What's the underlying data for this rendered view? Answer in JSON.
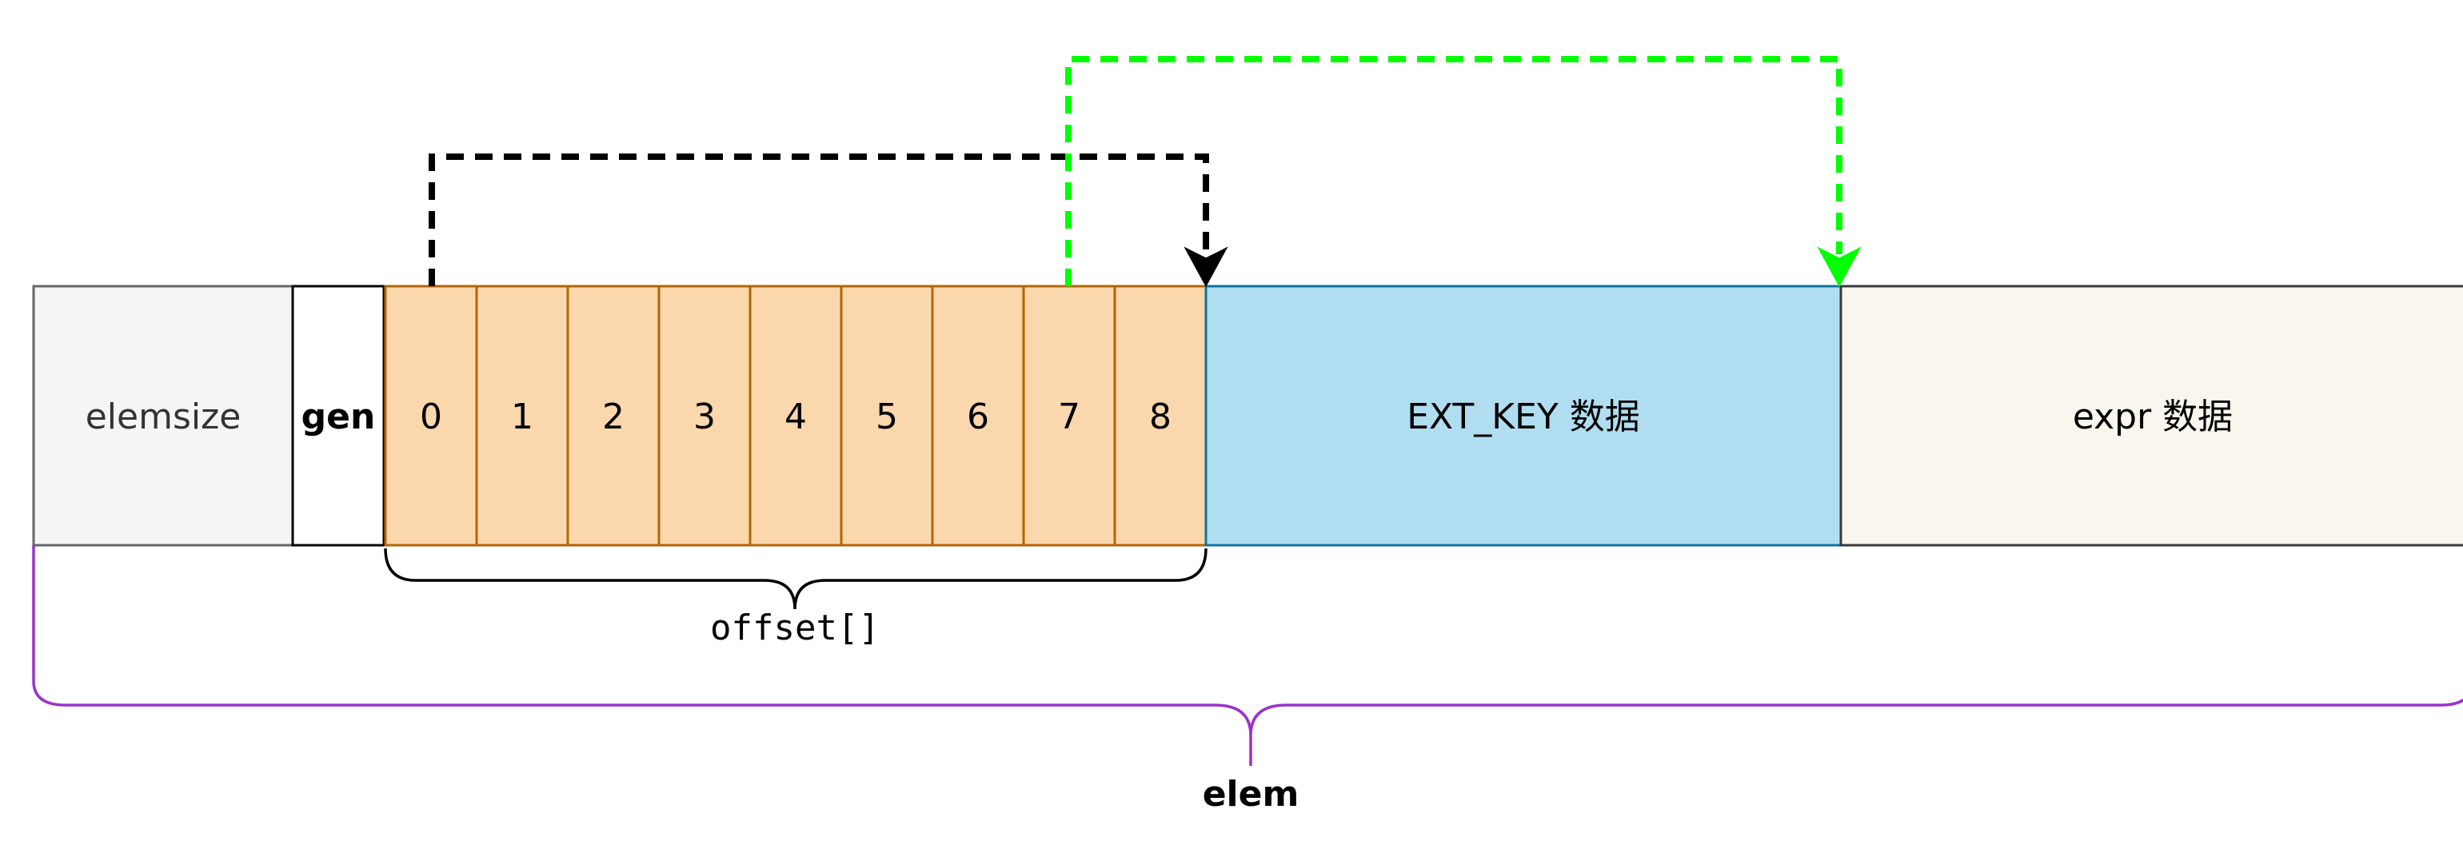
{
  "diagram": {
    "segments": {
      "elemsize": "elemsize",
      "gen": "gen",
      "ext_key": "EXT_KEY 数据",
      "expr": "expr 数据"
    },
    "offset_cells": [
      "0",
      "1",
      "2",
      "3",
      "4",
      "5",
      "6",
      "7",
      "8"
    ],
    "offset_label": "offset[]",
    "elem_label": "elem"
  },
  "colors": {
    "elemsize_fill": "#f5f5f5",
    "elemsize_stroke": "#666666",
    "gen_fill": "#ffffff",
    "offset_fill": "#fad7ac",
    "offset_stroke": "#b46504",
    "ext_key_fill": "#b1ddf0",
    "ext_key_stroke": "#10739e",
    "expr_fill": "#f9f7ed",
    "expr_stroke": "#36393d",
    "black_arrow": "#000000",
    "green_arrow": "#00ff00",
    "elem_brace": "#9933cc"
  }
}
